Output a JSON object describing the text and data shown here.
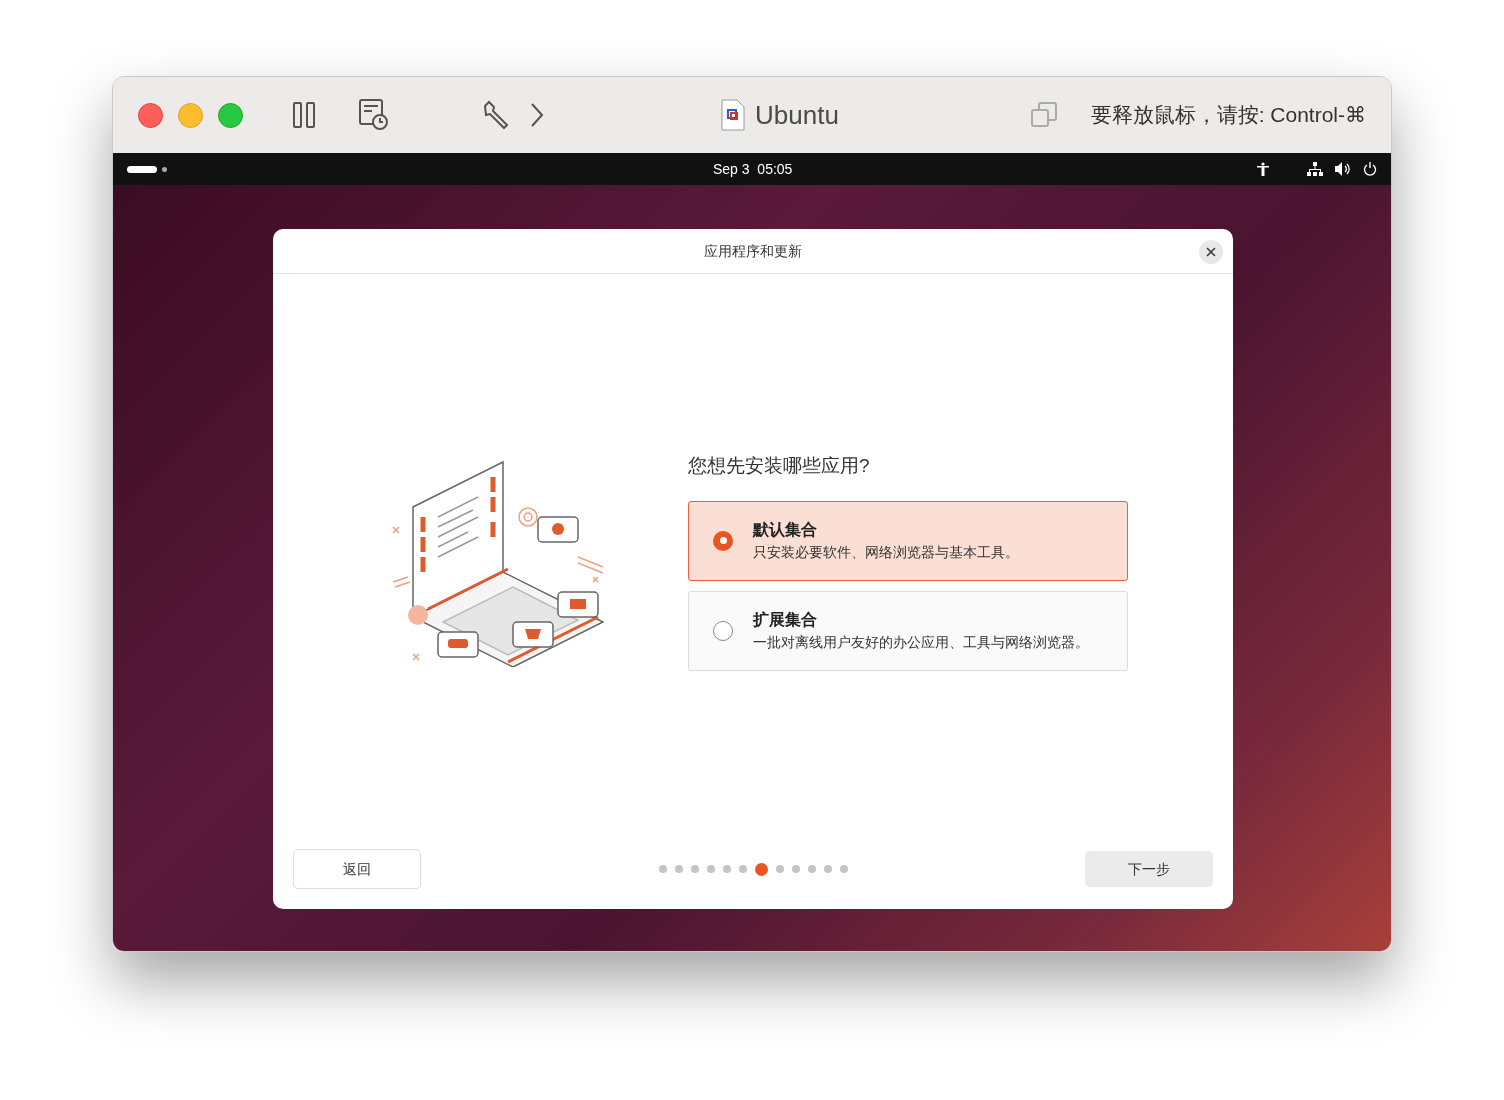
{
  "window": {
    "title": "Ubuntu",
    "release_hint": "要释放鼠标，请按: Control-⌘"
  },
  "top_bar": {
    "clock": "Sep 3  05:05"
  },
  "dialog": {
    "title": "应用程序和更新",
    "question": "您想先安装哪些应用?",
    "options": [
      {
        "title": "默认集合",
        "description": "只安装必要软件、网络浏览器与基本工具。",
        "selected": true
      },
      {
        "title": "扩展集合",
        "description": "一批对离线用户友好的办公应用、工具与网络浏览器。",
        "selected": false
      }
    ],
    "back_button": "返回",
    "next_button": "下一步",
    "steps": [
      {
        "selected": false
      },
      {
        "selected": false
      },
      {
        "selected": false
      },
      {
        "selected": false
      },
      {
        "selected": false
      },
      {
        "selected": false
      },
      {
        "selected": true
      },
      {
        "selected": false
      },
      {
        "selected": false
      },
      {
        "selected": false
      },
      {
        "selected": false
      },
      {
        "selected": false
      }
    ]
  }
}
